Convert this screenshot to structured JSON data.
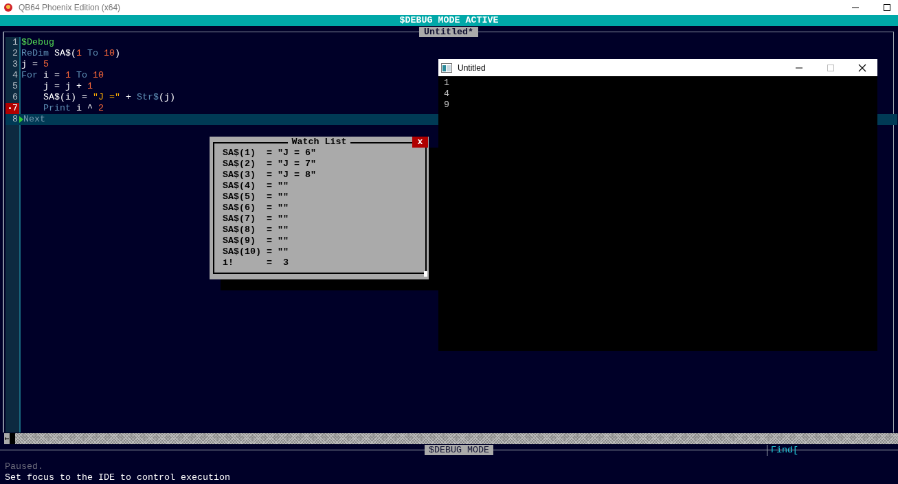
{
  "window": {
    "title": "QB64 Phoenix Edition (x64)"
  },
  "banner": "$DEBUG MODE ACTIVE",
  "editor": {
    "tab": "Untitled*",
    "lines": [
      {
        "number": "1",
        "breakpoint": false,
        "current": false,
        "tokens": [
          {
            "text": "$Debug",
            "kind": "meta"
          }
        ]
      },
      {
        "number": "2",
        "breakpoint": false,
        "current": false,
        "tokens": [
          {
            "text": "ReDim",
            "kind": "keyword"
          },
          {
            "text": " SA$(",
            "kind": "plain"
          },
          {
            "text": "1",
            "kind": "number"
          },
          {
            "text": " To ",
            "kind": "keyword"
          },
          {
            "text": "10",
            "kind": "number"
          },
          {
            "text": ")",
            "kind": "plain"
          }
        ]
      },
      {
        "number": "3",
        "breakpoint": false,
        "current": false,
        "tokens": [
          {
            "text": "j = ",
            "kind": "plain"
          },
          {
            "text": "5",
            "kind": "number"
          }
        ]
      },
      {
        "number": "4",
        "breakpoint": false,
        "current": false,
        "tokens": [
          {
            "text": "For",
            "kind": "keyword"
          },
          {
            "text": " i = ",
            "kind": "plain"
          },
          {
            "text": "1",
            "kind": "number"
          },
          {
            "text": " To ",
            "kind": "keyword"
          },
          {
            "text": "10",
            "kind": "number"
          }
        ]
      },
      {
        "number": "5",
        "breakpoint": false,
        "current": false,
        "tokens": [
          {
            "text": "    j = j + ",
            "kind": "plain"
          },
          {
            "text": "1",
            "kind": "number"
          }
        ]
      },
      {
        "number": "6",
        "breakpoint": false,
        "current": false,
        "tokens": [
          {
            "text": "    SA$(i) = ",
            "kind": "plain"
          },
          {
            "text": "\"J =\"",
            "kind": "string"
          },
          {
            "text": " + ",
            "kind": "plain"
          },
          {
            "text": "Str$",
            "kind": "keyword"
          },
          {
            "text": "(j)",
            "kind": "plain"
          }
        ]
      },
      {
        "number": "7",
        "breakpoint": true,
        "current": false,
        "tokens": [
          {
            "text": "    Print",
            "kind": "keyword"
          },
          {
            "text": " i ^ ",
            "kind": "plain"
          },
          {
            "text": "2",
            "kind": "number"
          }
        ]
      },
      {
        "number": "8",
        "breakpoint": false,
        "current": true,
        "tokens": [
          {
            "text": "Next",
            "kind": "keyword"
          }
        ]
      }
    ]
  },
  "watch_list": {
    "title": "Watch List",
    "close": "x",
    "rows": [
      "SA$(1)  = \"J = 6\"",
      "SA$(2)  = \"J = 7\"",
      "SA$(3)  = \"J = 8\"",
      "SA$(4)  = \"\"",
      "SA$(5)  = \"\"",
      "SA$(6)  = \"\"",
      "SA$(7)  = \"\"",
      "SA$(8)  = \"\"",
      "SA$(9)  = \"\"",
      "SA$(10) = \"\"",
      "i!      =  3"
    ]
  },
  "output_window": {
    "title": "Untitled",
    "lines": [
      "1",
      "4",
      "9"
    ]
  },
  "status_bar": {
    "mode": "$DEBUG MODE",
    "find": "Find[",
    "messages": [
      {
        "text": "Paused.",
        "kind": "dim"
      },
      {
        "text": "Set focus to the IDE to control execution",
        "kind": "normal"
      }
    ]
  }
}
